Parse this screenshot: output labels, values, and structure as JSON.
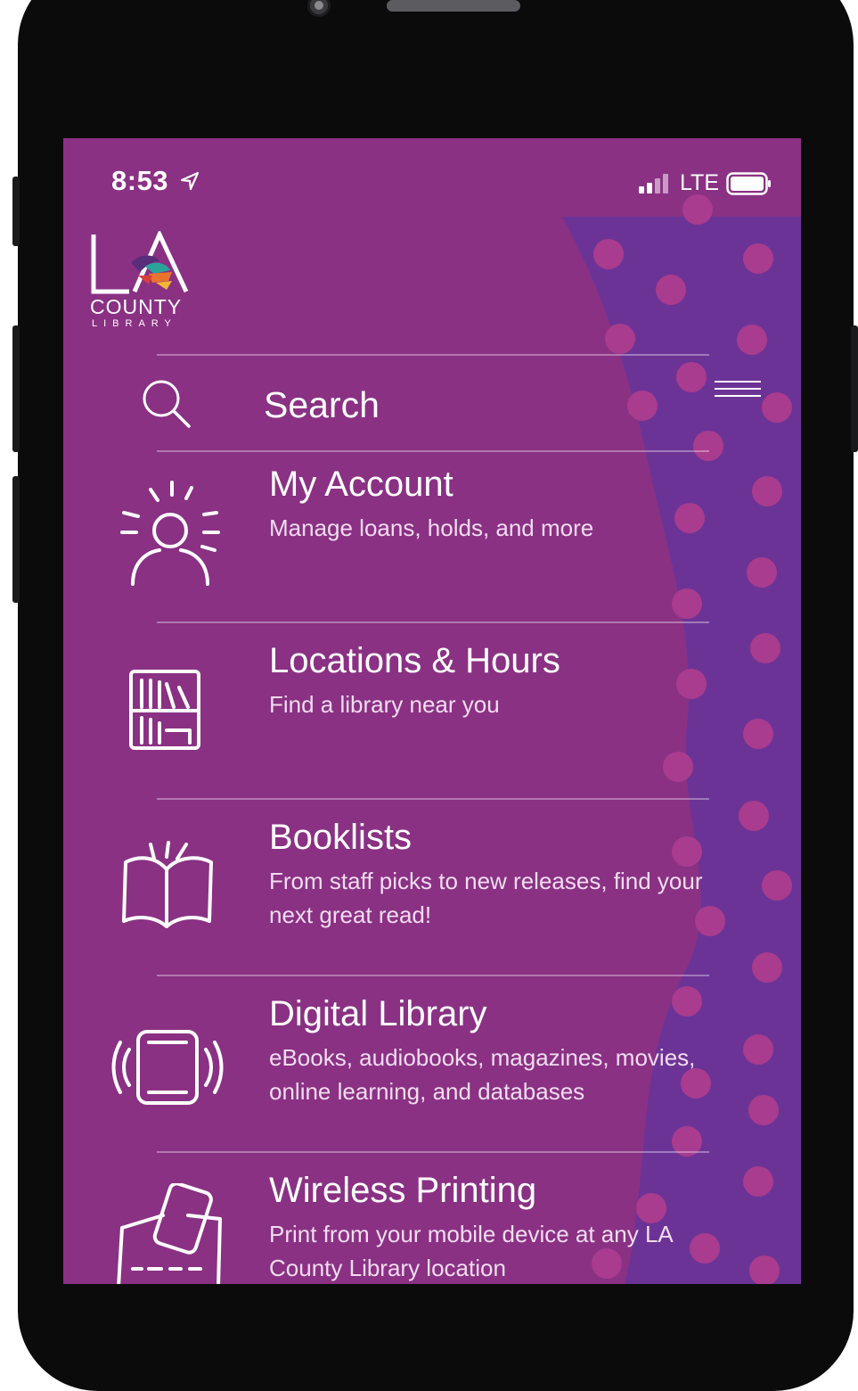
{
  "status_bar": {
    "time": "8:53",
    "carrier": "LTE"
  },
  "logo": {
    "top": "LA",
    "middle": "COUNTY",
    "bottom": "LIBRARY"
  },
  "search": {
    "label": "Search"
  },
  "menu_items": [
    {
      "title": "My Account",
      "subtitle": "Manage loans, holds, and more",
      "icon": "person-icon"
    },
    {
      "title": "Locations & Hours",
      "subtitle": "Find a library near you",
      "icon": "bookshelf-icon"
    },
    {
      "title": "Booklists",
      "subtitle": "From staff picks to new releases, find your next great read!",
      "icon": "open-book-icon"
    },
    {
      "title": "Digital Library",
      "subtitle": "eBooks, audiobooks, magazines, movies, online learning, and databases",
      "icon": "tablet-icon"
    },
    {
      "title": "Wireless Printing",
      "subtitle": "Print from your mobile device at any LA County Library location",
      "icon": "printer-icon"
    }
  ],
  "colors": {
    "screen_bg": "#8a3184",
    "accent_band": "#6c3397",
    "dots": "#a83a8a"
  }
}
